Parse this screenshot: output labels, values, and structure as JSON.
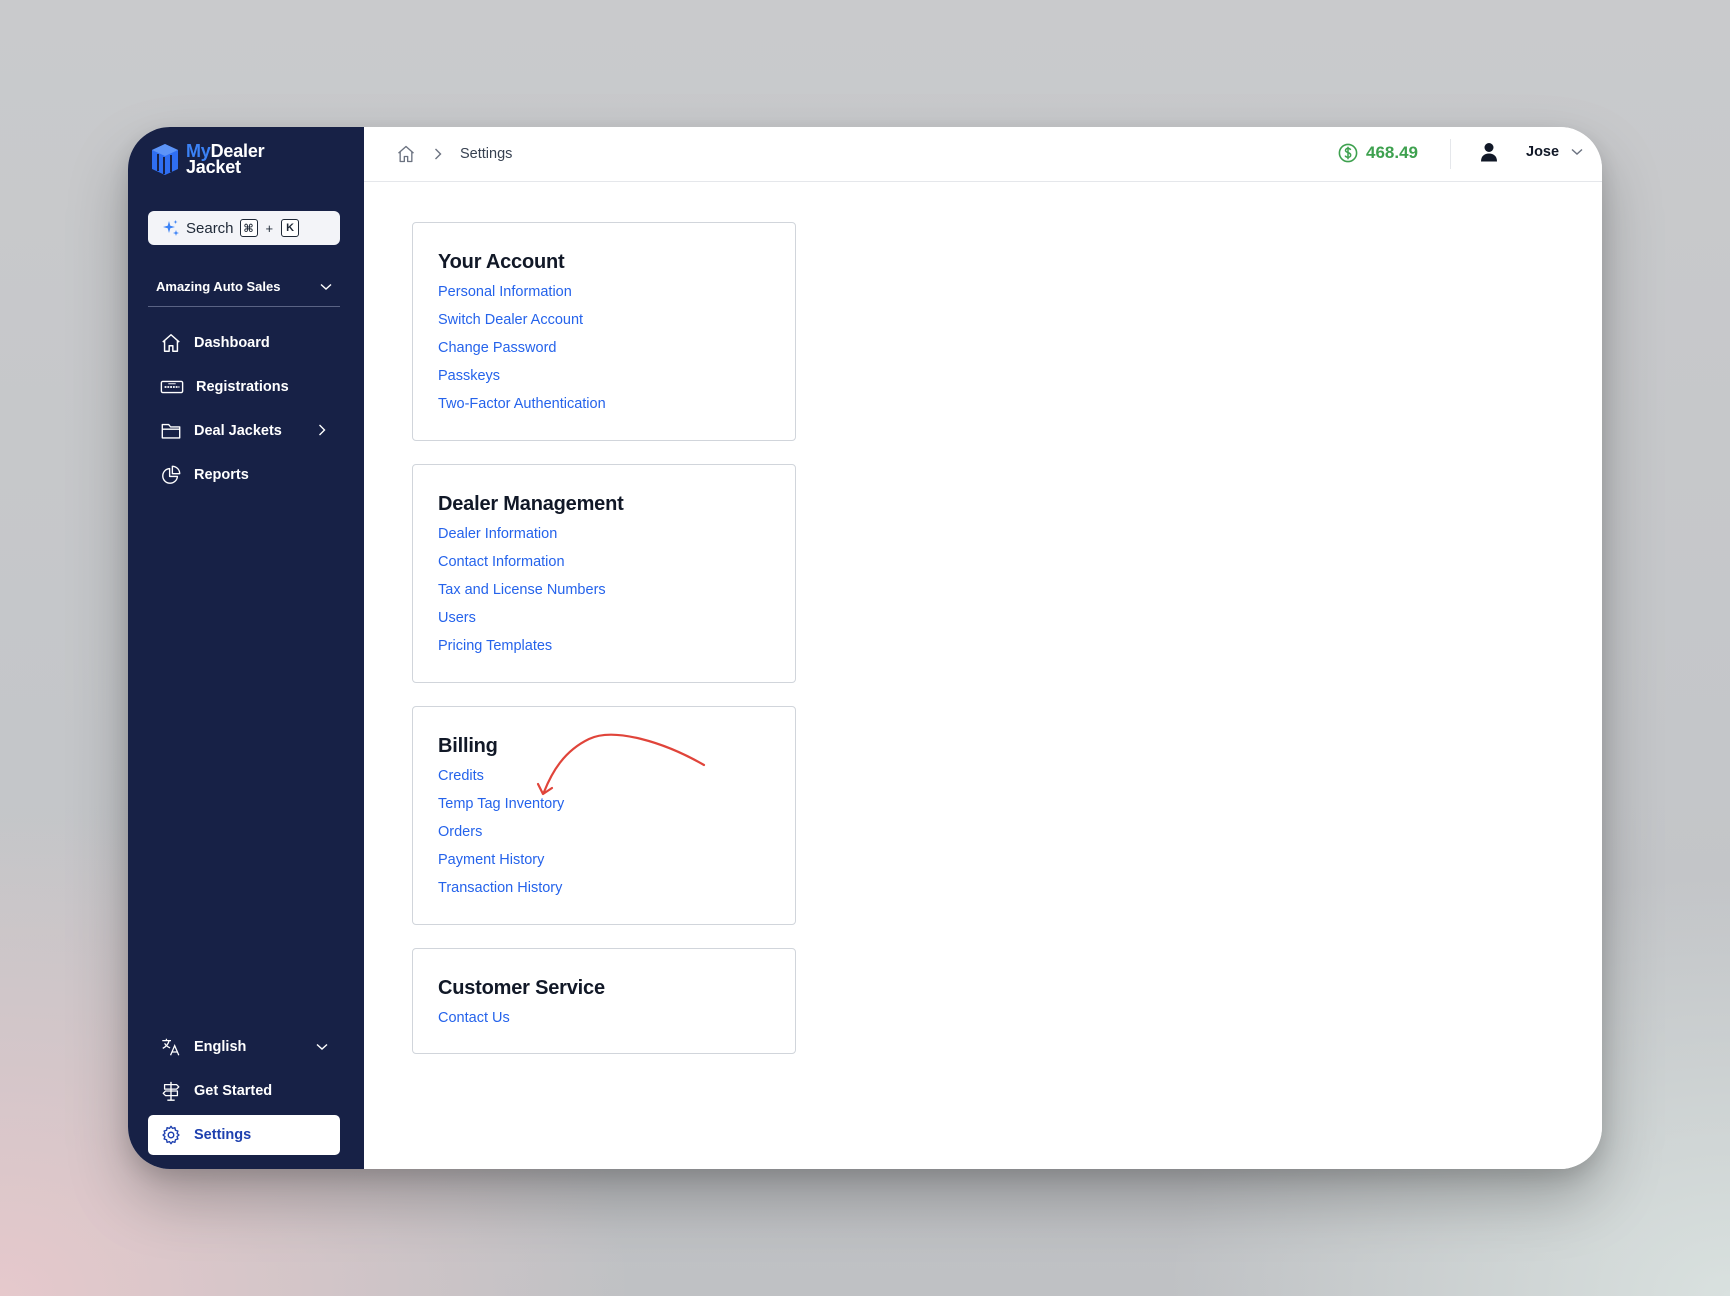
{
  "brand": {
    "my": "My",
    "dealer": "Dealer",
    "jacket": "Jacket"
  },
  "search": {
    "label": "Search",
    "key1": "⌘",
    "plus": "+",
    "key2": "K"
  },
  "dealer_account": "Amazing Auto Sales",
  "nav": {
    "dashboard": "Dashboard",
    "registrations": "Registrations",
    "deal_jackets": "Deal Jackets",
    "reports": "Reports",
    "language": "English",
    "get_started": "Get Started",
    "settings": "Settings"
  },
  "breadcrumb": {
    "current": "Settings"
  },
  "balance": "468.49",
  "user": {
    "name": "Jose"
  },
  "sections": {
    "account": {
      "title": "Your Account",
      "links": [
        "Personal Information",
        "Switch Dealer Account",
        "Change Password",
        "Passkeys",
        "Two-Factor Authentication"
      ]
    },
    "dealer": {
      "title": "Dealer Management",
      "links": [
        "Dealer Information",
        "Contact Information",
        "Tax and License Numbers",
        "Users",
        "Pricing Templates"
      ]
    },
    "billing": {
      "title": "Billing",
      "links": [
        "Credits",
        "Temp Tag Inventory",
        "Orders",
        "Payment History",
        "Transaction History"
      ]
    },
    "service": {
      "title": "Customer Service",
      "links": [
        "Contact Us"
      ]
    }
  },
  "colors": {
    "sidebar_bg": "#172146",
    "accent_blue": "#2563eb",
    "balance_green": "#3ea14f",
    "annotation_red": "#e0443a"
  }
}
